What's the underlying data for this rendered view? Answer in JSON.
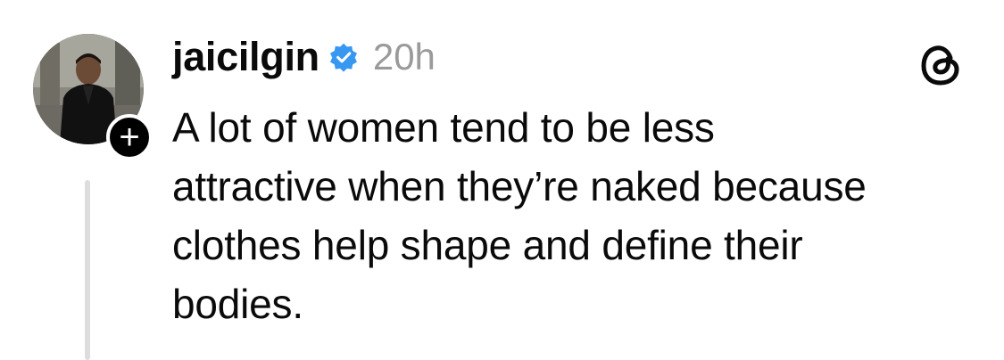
{
  "post": {
    "username": "jaicilgin",
    "timestamp": "20h",
    "verified": true,
    "text_lines": [
      "A lot of women tend to be less",
      "attractive when they’re naked because",
      "clothes help shape and define their",
      "bodies."
    ],
    "follow_badge": "+"
  },
  "icons": {
    "verified": "verified-badge-icon",
    "app": "threads-logo-icon"
  },
  "colors": {
    "verified": "#3897f0",
    "timestamp": "#9a9a9a",
    "thread_line": "#dddddd"
  }
}
